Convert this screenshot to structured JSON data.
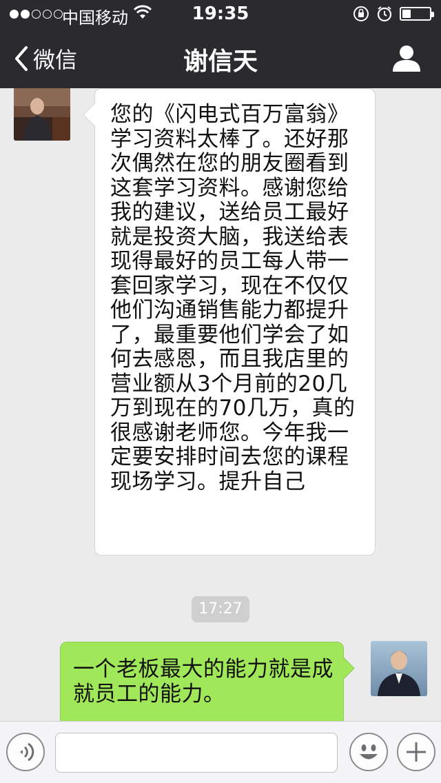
{
  "status_bar": {
    "carrier": "中国移动",
    "time": "19:35"
  },
  "nav": {
    "back_label": "微信",
    "title": "谢信天"
  },
  "messages": [
    {
      "direction": "incoming",
      "text": "您的《闪电式百万富翁》学习资料太棒了。还好那次偶然在您的朋友圈看到这套学习资料。感谢您给我的建议，送给员工最好就是投资大脑，我送给表现得最好的员工每人带一套回家学习，现在不仅仅他们沟通销售能力都提升了，最重要他们学会了如何去感恩，而且我店里的营业额从3个月前的20几万到现在的70几万，真的很感谢老师您。今年我一定要安排时间去您的课程现场学习。提升自己"
    },
    {
      "direction": "timestamp",
      "text": "17:27"
    },
    {
      "direction": "outgoing",
      "text": "一个老板最大的能力就是成就员工的能力。"
    }
  ],
  "input_bar": {
    "placeholder": ""
  },
  "colors": {
    "header_bg": "#2b2b2f",
    "chat_bg": "#ebebeb",
    "incoming_bubble": "#ffffff",
    "outgoing_bubble": "#a0e75a",
    "timestamp_chip": "#cfcfcf"
  },
  "icons": {
    "back": "chevron-left-icon",
    "profile": "person-icon",
    "voice": "voice-icon",
    "emoji": "smiley-icon",
    "more": "plus-icon",
    "wifi": "wifi-icon",
    "rotation_lock": "rotation-lock-icon",
    "alarm": "alarm-icon",
    "battery": "battery-icon"
  }
}
